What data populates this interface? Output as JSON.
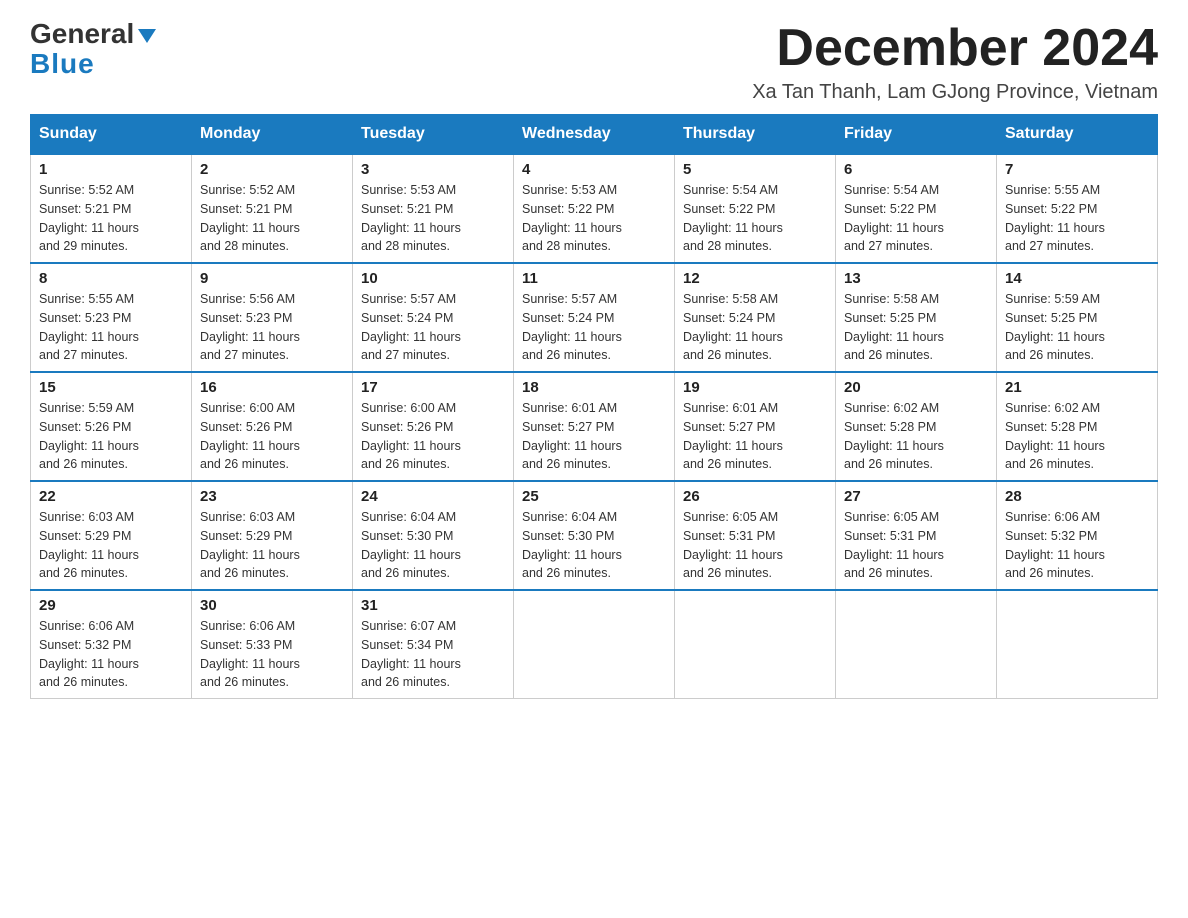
{
  "header": {
    "logo_general": "General",
    "logo_blue": "Blue",
    "month_title": "December 2024",
    "location": "Xa Tan Thanh, Lam GJong Province, Vietnam"
  },
  "days_of_week": [
    "Sunday",
    "Monday",
    "Tuesday",
    "Wednesday",
    "Thursday",
    "Friday",
    "Saturday"
  ],
  "weeks": [
    [
      {
        "day": "1",
        "sunrise": "5:52 AM",
        "sunset": "5:21 PM",
        "daylight": "11 hours and 29 minutes."
      },
      {
        "day": "2",
        "sunrise": "5:52 AM",
        "sunset": "5:21 PM",
        "daylight": "11 hours and 28 minutes."
      },
      {
        "day": "3",
        "sunrise": "5:53 AM",
        "sunset": "5:21 PM",
        "daylight": "11 hours and 28 minutes."
      },
      {
        "day": "4",
        "sunrise": "5:53 AM",
        "sunset": "5:22 PM",
        "daylight": "11 hours and 28 minutes."
      },
      {
        "day": "5",
        "sunrise": "5:54 AM",
        "sunset": "5:22 PM",
        "daylight": "11 hours and 28 minutes."
      },
      {
        "day": "6",
        "sunrise": "5:54 AM",
        "sunset": "5:22 PM",
        "daylight": "11 hours and 27 minutes."
      },
      {
        "day": "7",
        "sunrise": "5:55 AM",
        "sunset": "5:22 PM",
        "daylight": "11 hours and 27 minutes."
      }
    ],
    [
      {
        "day": "8",
        "sunrise": "5:55 AM",
        "sunset": "5:23 PM",
        "daylight": "11 hours and 27 minutes."
      },
      {
        "day": "9",
        "sunrise": "5:56 AM",
        "sunset": "5:23 PM",
        "daylight": "11 hours and 27 minutes."
      },
      {
        "day": "10",
        "sunrise": "5:57 AM",
        "sunset": "5:24 PM",
        "daylight": "11 hours and 27 minutes."
      },
      {
        "day": "11",
        "sunrise": "5:57 AM",
        "sunset": "5:24 PM",
        "daylight": "11 hours and 26 minutes."
      },
      {
        "day": "12",
        "sunrise": "5:58 AM",
        "sunset": "5:24 PM",
        "daylight": "11 hours and 26 minutes."
      },
      {
        "day": "13",
        "sunrise": "5:58 AM",
        "sunset": "5:25 PM",
        "daylight": "11 hours and 26 minutes."
      },
      {
        "day": "14",
        "sunrise": "5:59 AM",
        "sunset": "5:25 PM",
        "daylight": "11 hours and 26 minutes."
      }
    ],
    [
      {
        "day": "15",
        "sunrise": "5:59 AM",
        "sunset": "5:26 PM",
        "daylight": "11 hours and 26 minutes."
      },
      {
        "day": "16",
        "sunrise": "6:00 AM",
        "sunset": "5:26 PM",
        "daylight": "11 hours and 26 minutes."
      },
      {
        "day": "17",
        "sunrise": "6:00 AM",
        "sunset": "5:26 PM",
        "daylight": "11 hours and 26 minutes."
      },
      {
        "day": "18",
        "sunrise": "6:01 AM",
        "sunset": "5:27 PM",
        "daylight": "11 hours and 26 minutes."
      },
      {
        "day": "19",
        "sunrise": "6:01 AM",
        "sunset": "5:27 PM",
        "daylight": "11 hours and 26 minutes."
      },
      {
        "day": "20",
        "sunrise": "6:02 AM",
        "sunset": "5:28 PM",
        "daylight": "11 hours and 26 minutes."
      },
      {
        "day": "21",
        "sunrise": "6:02 AM",
        "sunset": "5:28 PM",
        "daylight": "11 hours and 26 minutes."
      }
    ],
    [
      {
        "day": "22",
        "sunrise": "6:03 AM",
        "sunset": "5:29 PM",
        "daylight": "11 hours and 26 minutes."
      },
      {
        "day": "23",
        "sunrise": "6:03 AM",
        "sunset": "5:29 PM",
        "daylight": "11 hours and 26 minutes."
      },
      {
        "day": "24",
        "sunrise": "6:04 AM",
        "sunset": "5:30 PM",
        "daylight": "11 hours and 26 minutes."
      },
      {
        "day": "25",
        "sunrise": "6:04 AM",
        "sunset": "5:30 PM",
        "daylight": "11 hours and 26 minutes."
      },
      {
        "day": "26",
        "sunrise": "6:05 AM",
        "sunset": "5:31 PM",
        "daylight": "11 hours and 26 minutes."
      },
      {
        "day": "27",
        "sunrise": "6:05 AM",
        "sunset": "5:31 PM",
        "daylight": "11 hours and 26 minutes."
      },
      {
        "day": "28",
        "sunrise": "6:06 AM",
        "sunset": "5:32 PM",
        "daylight": "11 hours and 26 minutes."
      }
    ],
    [
      {
        "day": "29",
        "sunrise": "6:06 AM",
        "sunset": "5:32 PM",
        "daylight": "11 hours and 26 minutes."
      },
      {
        "day": "30",
        "sunrise": "6:06 AM",
        "sunset": "5:33 PM",
        "daylight": "11 hours and 26 minutes."
      },
      {
        "day": "31",
        "sunrise": "6:07 AM",
        "sunset": "5:34 PM",
        "daylight": "11 hours and 26 minutes."
      },
      null,
      null,
      null,
      null
    ]
  ],
  "labels": {
    "sunrise": "Sunrise:",
    "sunset": "Sunset:",
    "daylight": "Daylight:"
  }
}
